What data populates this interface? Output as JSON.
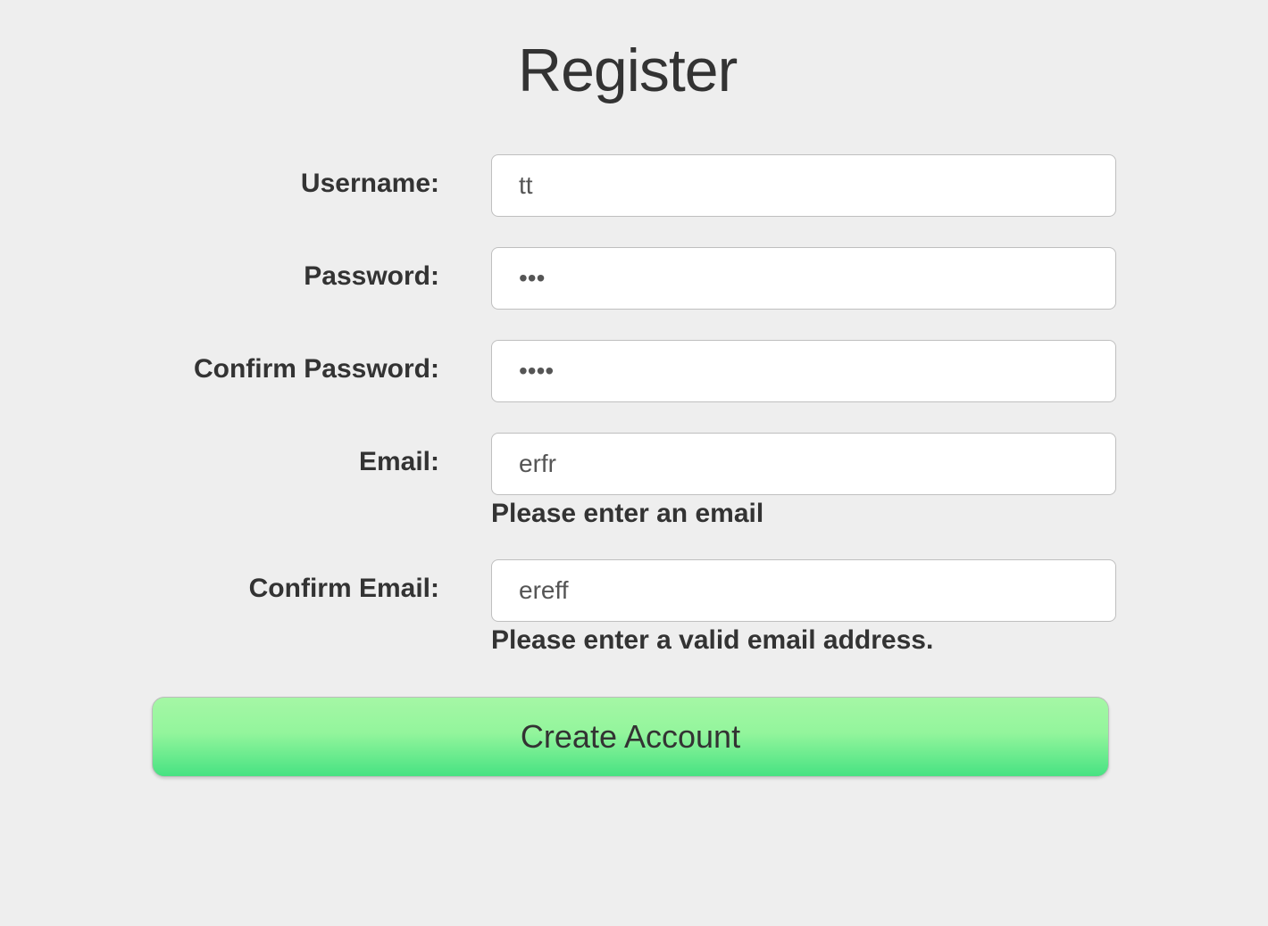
{
  "page": {
    "title": "Register"
  },
  "form": {
    "username": {
      "label": "Username:",
      "value": "tt"
    },
    "password": {
      "label": "Password:",
      "value": "•••"
    },
    "confirm_password": {
      "label": "Confirm Password:",
      "value": "••••"
    },
    "email": {
      "label": "Email:",
      "value": "erfr",
      "error": "Please enter an email"
    },
    "confirm_email": {
      "label": "Confirm Email:",
      "value": "ereff",
      "error": "Please enter a valid email address."
    },
    "submit": {
      "label": "Create Account"
    }
  }
}
